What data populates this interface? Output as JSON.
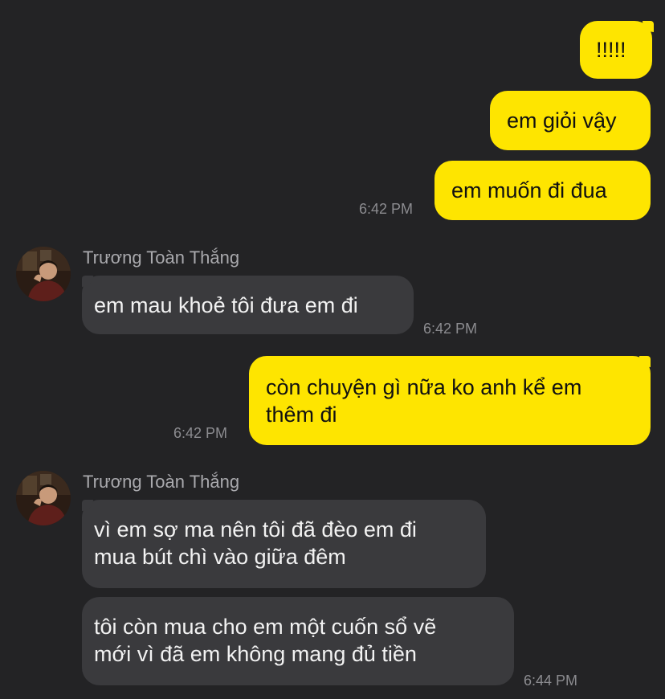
{
  "colors": {
    "background": "#232325",
    "outgoing_bubble": "#FEE500",
    "incoming_bubble": "#3A3A3D",
    "timestamp": "#8C8C90",
    "sender_name": "#A9A9AD"
  },
  "messages": [
    {
      "direction": "outgoing",
      "text": "!!!!!"
    },
    {
      "direction": "outgoing",
      "text": "em giỏi vậy"
    },
    {
      "direction": "outgoing",
      "text": "em muốn đi đua",
      "time": "6:42 PM"
    },
    {
      "direction": "incoming",
      "sender": "Trương Toàn Thắng",
      "text": "em mau khoẻ tôi đưa em đi",
      "time": "6:42 PM"
    },
    {
      "direction": "outgoing",
      "lines": [
        "còn chuyện gì nữa ko anh kể em",
        "thêm đi"
      ],
      "time": "6:42 PM"
    },
    {
      "direction": "incoming",
      "sender": "Trương Toàn Thắng",
      "lines": [
        "vì em sợ ma nên tôi đã đèo em đi",
        "mua bút chì vào giữa đêm"
      ]
    },
    {
      "direction": "incoming",
      "lines": [
        "tôi còn mua cho em một cuốn sổ vẽ",
        "mới vì đã em không mang đủ tiền"
      ],
      "time": "6:44 PM"
    }
  ],
  "avatar_icon": "profile-photo"
}
